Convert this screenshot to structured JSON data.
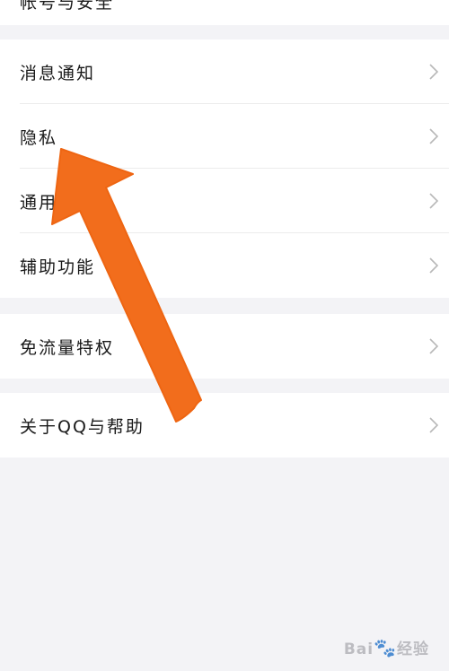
{
  "top_partial": {
    "label": "帐号与安全"
  },
  "settings": {
    "group_a": [
      {
        "label": "消息通知"
      },
      {
        "label": "隐私"
      },
      {
        "label": "通用"
      },
      {
        "label": "辅助功能"
      }
    ],
    "group_b": [
      {
        "label": "免流量特权"
      }
    ],
    "group_c": [
      {
        "label": "关于QQ与帮助"
      }
    ]
  },
  "watermark": {
    "text": "Bai",
    "paw": "🐾",
    "suffix": "经验"
  },
  "colors": {
    "background": "#f3f3f6",
    "row": "#ffffff",
    "arrow": "#f26d1c",
    "chevron": "#b8b8b8"
  },
  "icons": {
    "chevron": "chevron-right-icon"
  }
}
